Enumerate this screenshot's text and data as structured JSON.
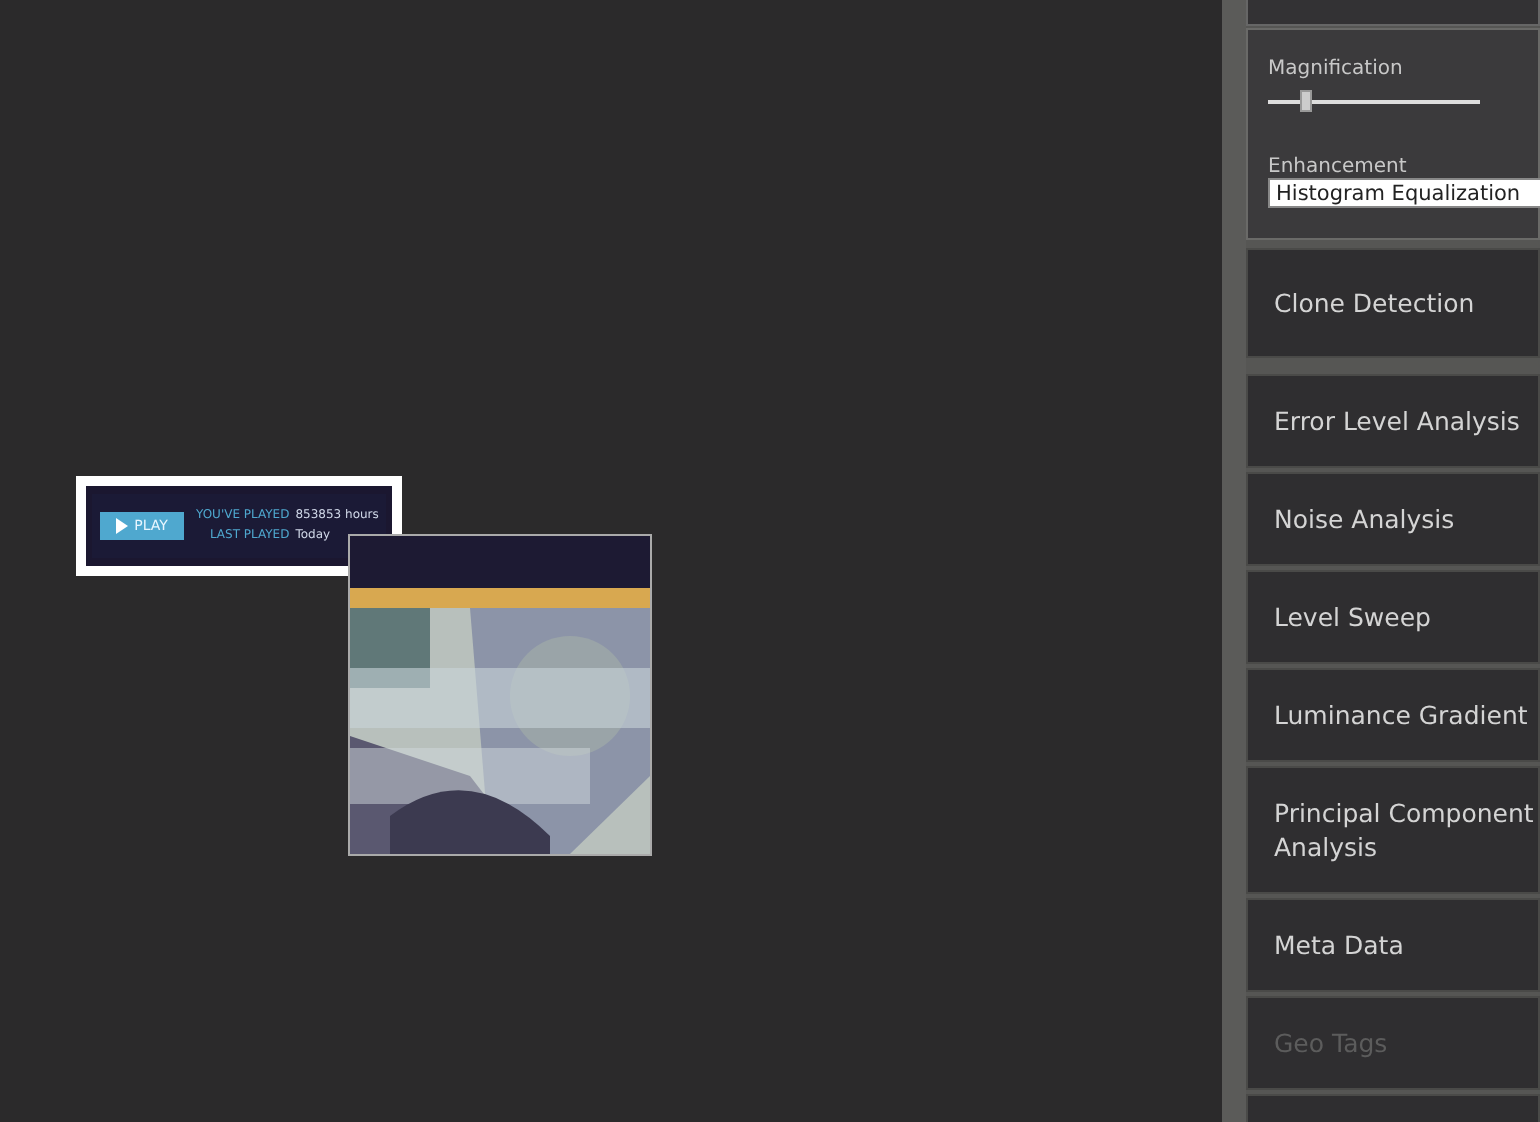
{
  "canvas": {
    "image": {
      "play_button": "PLAY",
      "played_label": "YOU'VE PLAYED",
      "played_value": "853853 hours",
      "last_label": "LAST PLAYED",
      "last_value": "Today"
    }
  },
  "sidebar": {
    "magnification": {
      "label": "Magnification",
      "level": 0.18
    },
    "enhancement": {
      "label": "Enhancement",
      "value": "Histogram Equalization"
    },
    "tools": [
      {
        "label": "Clone Detection",
        "disabled": false
      },
      {
        "label": "Error Level Analysis",
        "disabled": false
      },
      {
        "label": "Noise Analysis",
        "disabled": false
      },
      {
        "label": "Level Sweep",
        "disabled": false
      },
      {
        "label": "Luminance Gradient",
        "disabled": false
      },
      {
        "label": "Principal Component Analysis",
        "disabled": false
      },
      {
        "label": "Meta Data",
        "disabled": false
      },
      {
        "label": "Geo Tags",
        "disabled": true
      }
    ]
  }
}
